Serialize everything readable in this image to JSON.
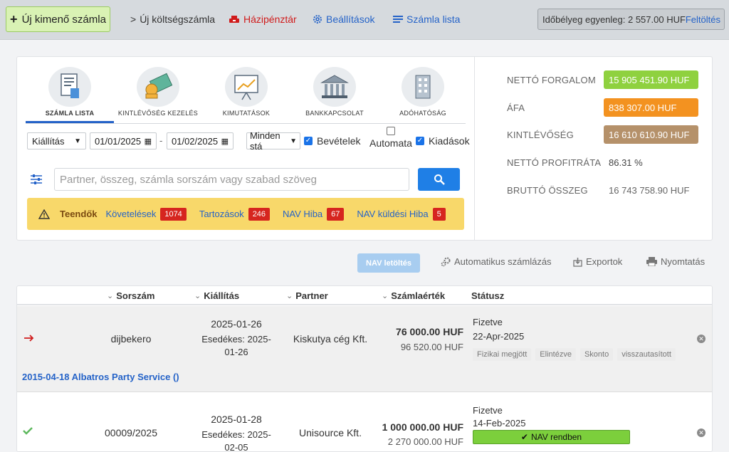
{
  "topbar": {
    "new_invoice": "Új kimenő számla",
    "new_expense": "Új költségszámla",
    "cash_register": "Házipénztár",
    "settings": "Beállítások",
    "invoice_list": "Számla lista",
    "stamp_balance": "Időbélyeg egyenleg: 2 557.00 HUF",
    "topup": "Feltöltés"
  },
  "tabs": [
    {
      "label": "Számla lista",
      "icon": "invoice-list-icon",
      "active": true
    },
    {
      "label": "Kintlévőség kezelés",
      "icon": "money-icon",
      "active": false
    },
    {
      "label": "Kimutatások",
      "icon": "chart-board-icon",
      "active": false
    },
    {
      "label": "Bankkapcsolat",
      "icon": "bank-icon",
      "active": false
    },
    {
      "label": "Adóhatóság",
      "icon": "building-icon",
      "active": false
    }
  ],
  "filters": {
    "date_type": "Kiállítás",
    "date_from": "01/01/2025",
    "date_to": "01/02/2025",
    "status": "Minden stá",
    "income_label": "Bevételek",
    "automatic_label": "Automata",
    "expense_label": "Kiadások"
  },
  "search": {
    "placeholder": "Partner, összeg, számla sorszám vagy szabad szöveg"
  },
  "todo": {
    "title": "Teendők",
    "items": [
      {
        "label": "Követelések",
        "count": "1074"
      },
      {
        "label": "Tartozások",
        "count": "246"
      },
      {
        "label": "NAV Hiba",
        "count": "67"
      },
      {
        "label": "NAV küldési Hiba",
        "count": "5"
      }
    ]
  },
  "stats": [
    {
      "label": "Nettó forgalom",
      "value": "15 905 451.90 HUF",
      "color": "#8fd13f"
    },
    {
      "label": "Áfa",
      "value": "838 307.00 HUF",
      "color": "#f39220"
    },
    {
      "label": "Kintlévőség",
      "value": "16 610 610.90 HUF",
      "color": "#b5916a"
    },
    {
      "label": "Nettó profitráta",
      "value": "86.31 %",
      "color": ""
    },
    {
      "label": "Bruttó összeg",
      "value": "16 743 758.90 HUF",
      "color": ""
    }
  ],
  "actions": {
    "nav_download": "NAV letöltés",
    "auto_invoicing": "Automatikus számlázás",
    "export": "Exportok",
    "print": "Nyomtatás"
  },
  "table": {
    "headers": {
      "number": "Sorszám",
      "issued": "Kiállítás",
      "partner": "Partner",
      "value": "Számlaérték",
      "status": "Státusz"
    },
    "rows": [
      {
        "number": "dijbekero",
        "issued": "2025-01-26",
        "due": "Esedékes: 2025-01-26",
        "partner": "Kiskutya cég Kft.",
        "net": "76 000.00 HUF",
        "gross": "96 520.00 HUF",
        "status": "Fizetve",
        "status_date": "22-Apr-2025",
        "tags": [
          "Fizikai megjött",
          "Elintézve",
          "Skonto",
          "visszautasított"
        ],
        "note": "2015-04-18 Albatros Party Service ()"
      },
      {
        "number": "00009/2025",
        "issued": "2025-01-28",
        "due": "Esedékes: 2025-02-05",
        "partner": "Unisource Kft.",
        "net": "1 000 000.00 HUF",
        "gross": "2 270 000.00 HUF",
        "status": "Fizetve",
        "status_date": "14-Feb-2025",
        "nav_status": "NAV rendben"
      }
    ]
  }
}
